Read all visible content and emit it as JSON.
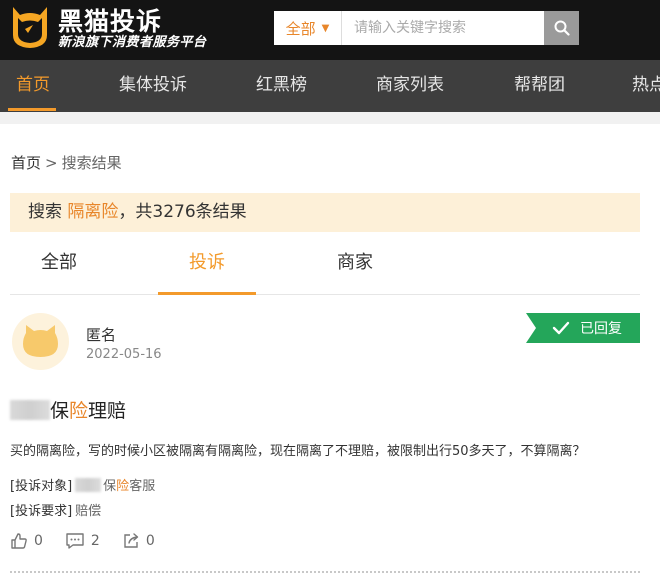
{
  "header": {
    "brand_title": "黑猫投诉",
    "brand_subtitle": "新浪旗下消费者服务平台",
    "search": {
      "category": "全部",
      "placeholder": "请输入关键字搜索"
    }
  },
  "nav": {
    "items": [
      {
        "label": "首页",
        "active": true
      },
      {
        "label": "集体投诉"
      },
      {
        "label": "红黑榜"
      },
      {
        "label": "商家列表"
      },
      {
        "label": "帮帮团"
      },
      {
        "label": "热点"
      }
    ]
  },
  "breadcrumb": {
    "home": "首页",
    "separator": ">",
    "current": "搜索结果"
  },
  "result": {
    "prefix": "搜索 ",
    "keyword": "隔离险",
    "suffix": "，共3276条结果"
  },
  "tabs": [
    {
      "label": "全部"
    },
    {
      "label": "投诉",
      "active": true
    },
    {
      "label": "商家"
    }
  ],
  "complaint": {
    "user": "匿名",
    "date": "2022-05-16",
    "status": "已回复",
    "title_parts": [
      "保",
      "险",
      "理赔"
    ],
    "body": "买的隔离险，写的时候小区被隔离有隔离险，现在隔离了不理赔，被限制出行50多天了，不算隔离？",
    "target_label": "[投诉对象]",
    "target_parts": [
      "保",
      "险",
      "客服"
    ],
    "request_label": "[投诉要求]",
    "request_value": "赔偿",
    "likes": "0",
    "comments": "2",
    "shares": "0"
  },
  "colors": {
    "accent": "#f39a2b",
    "status_green": "#24a65a",
    "header_bg": "#141414",
    "nav_bg": "#3e3e3e",
    "banner_bg": "#fdf0d8"
  }
}
